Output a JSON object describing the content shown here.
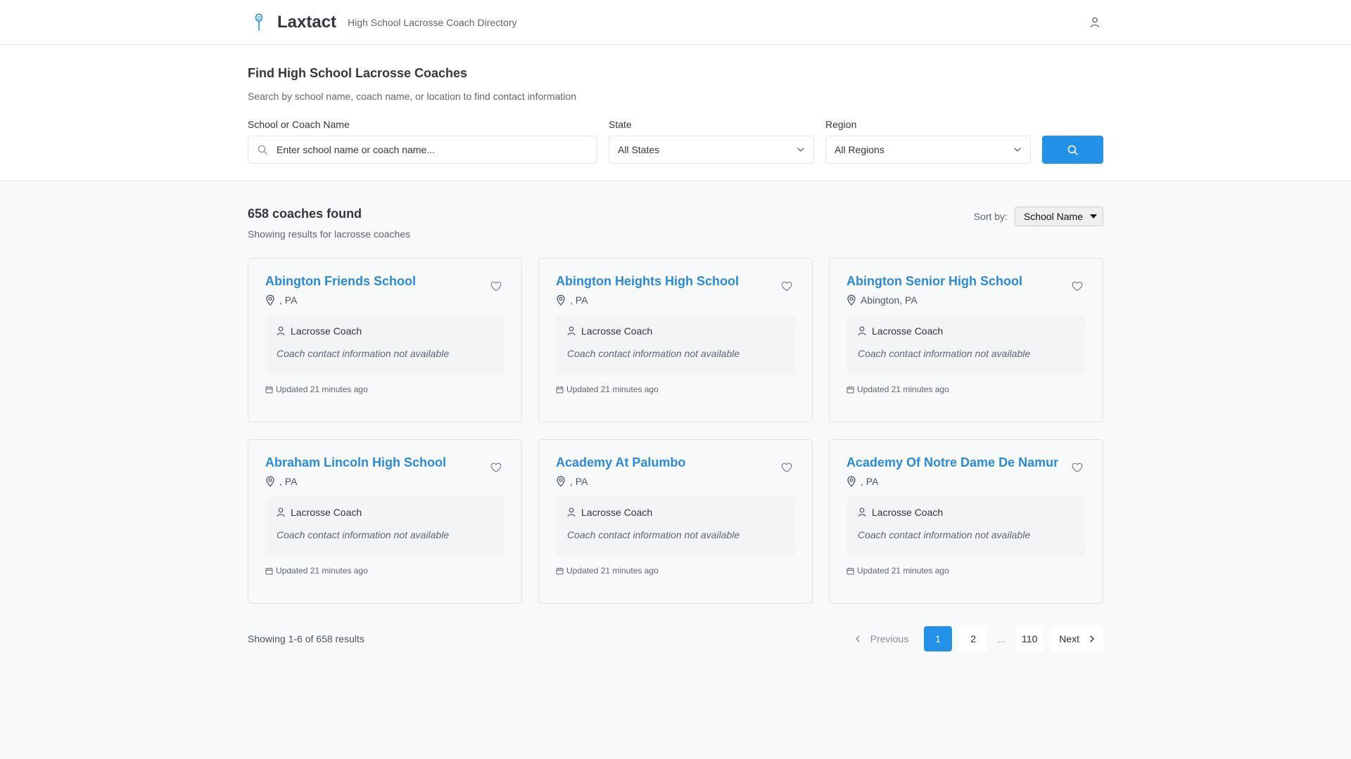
{
  "header": {
    "brand": "Laxtact",
    "tagline": "High School Lacrosse Coach Directory"
  },
  "search": {
    "title": "Find High School Lacrosse Coaches",
    "subtitle": "Search by school name, coach name, or location to find contact information",
    "name_label": "School or Coach Name",
    "name_placeholder": "Enter school name or coach name...",
    "state_label": "State",
    "state_value": "All States",
    "region_label": "Region",
    "region_value": "All Regions"
  },
  "results": {
    "count_label": "658 coaches found",
    "subtitle": "Showing results for lacrosse coaches",
    "sort_label": "Sort by:",
    "sort_value": "School Name",
    "cards": [
      {
        "school": "Abington Friends School",
        "location": ", PA",
        "role": "Lacrosse Coach",
        "contact": "Coach contact information not available",
        "updated": "Updated 21 minutes ago"
      },
      {
        "school": "Abington Heights High School",
        "location": ", PA",
        "role": "Lacrosse Coach",
        "contact": "Coach contact information not available",
        "updated": "Updated 21 minutes ago"
      },
      {
        "school": "Abington Senior High School",
        "location": "Abington, PA",
        "role": "Lacrosse Coach",
        "contact": "Coach contact information not available",
        "updated": "Updated 21 minutes ago"
      },
      {
        "school": "Abraham Lincoln High School",
        "location": ", PA",
        "role": "Lacrosse Coach",
        "contact": "Coach contact information not available",
        "updated": "Updated 21 minutes ago"
      },
      {
        "school": "Academy At Palumbo",
        "location": ", PA",
        "role": "Lacrosse Coach",
        "contact": "Coach contact information not available",
        "updated": "Updated 21 minutes ago"
      },
      {
        "school": "Academy Of Notre Dame De Namur",
        "location": ", PA",
        "role": "Lacrosse Coach",
        "contact": "Coach contact information not available",
        "updated": "Updated 21 minutes ago"
      }
    ]
  },
  "pagination": {
    "showing": "Showing 1-6 of 658 results",
    "previous": "Previous",
    "pages": [
      "1",
      "2"
    ],
    "ellipsis": "...",
    "last": "110",
    "next": "Next",
    "current": "1"
  },
  "colors": {
    "accent": "#2391e8",
    "link": "#2b8ad8"
  }
}
